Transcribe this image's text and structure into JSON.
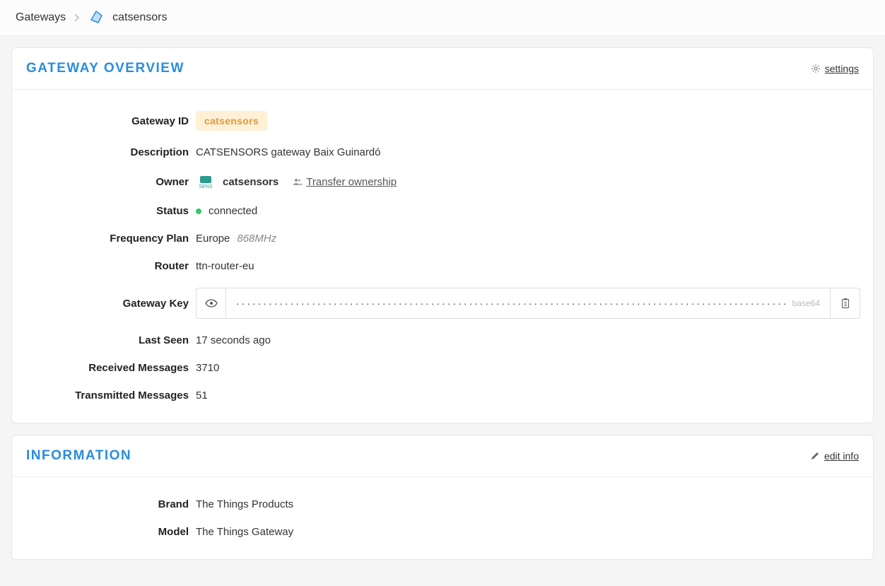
{
  "breadcrumb": {
    "root": "Gateways",
    "current": "catsensors"
  },
  "overview": {
    "title": "GATEWAY OVERVIEW",
    "settings_label": "settings",
    "labels": {
      "gateway_id": "Gateway ID",
      "description": "Description",
      "owner": "Owner",
      "status": "Status",
      "frequency_plan": "Frequency Plan",
      "router": "Router",
      "gateway_key": "Gateway Key",
      "last_seen": "Last Seen",
      "received": "Received Messages",
      "transmitted": "Transmitted Messages"
    },
    "gateway_id": "catsensors",
    "description": "CATSENSORS gateway Baix Guinardó",
    "owner": "catsensors",
    "transfer_label": "Transfer ownership",
    "status": "connected",
    "frequency_plan": "Europe",
    "frequency_mhz": "868MHz",
    "router": "ttn-router-eu",
    "key_masked": "···················································································································································································",
    "key_encoding": "base64",
    "last_seen": "17 seconds ago",
    "received": "3710",
    "transmitted": "51"
  },
  "information": {
    "title": "INFORMATION",
    "edit_label": "edit info",
    "labels": {
      "brand": "Brand",
      "model": "Model"
    },
    "brand": "The Things Products",
    "model": "The Things Gateway"
  }
}
